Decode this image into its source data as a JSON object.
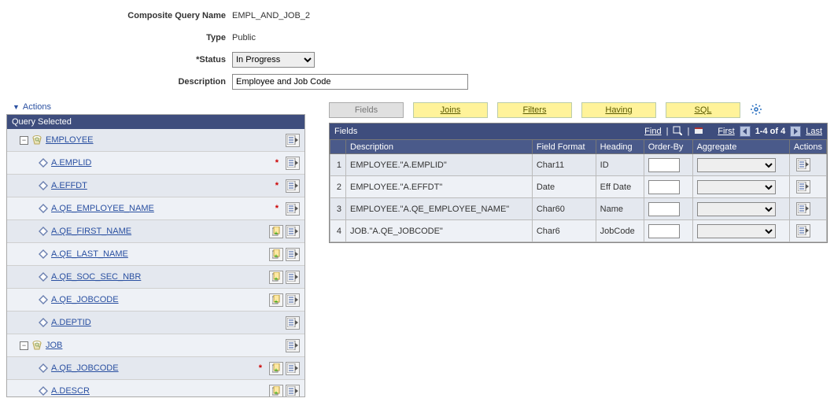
{
  "form": {
    "name_label": "Composite Query Name",
    "name_value": "EMPL_AND_JOB_2",
    "type_label": "Type",
    "type_value": "Public",
    "status_label": "*Status",
    "status_value": "In Progress",
    "desc_label": "Description",
    "desc_value": "Employee and Job Code"
  },
  "actions_link": "Actions",
  "query_selected_header": "Query Selected",
  "tree": [
    {
      "kind": "group",
      "label": "EMPLOYEE"
    },
    {
      "kind": "field",
      "label": "A.EMPLID",
      "req": true,
      "copy": false
    },
    {
      "kind": "field",
      "label": "A.EFFDT",
      "req": true,
      "copy": false
    },
    {
      "kind": "field",
      "label": "A.QE_EMPLOYEE_NAME",
      "req": true,
      "copy": false
    },
    {
      "kind": "field",
      "label": "A.QE_FIRST_NAME",
      "req": false,
      "copy": true
    },
    {
      "kind": "field",
      "label": "A.QE_LAST_NAME",
      "req": false,
      "copy": true
    },
    {
      "kind": "field",
      "label": "A.QE_SOC_SEC_NBR",
      "req": false,
      "copy": true
    },
    {
      "kind": "field",
      "label": "A.QE_JOBCODE",
      "req": false,
      "copy": true
    },
    {
      "kind": "field",
      "label": "A.DEPTID",
      "req": false,
      "copy": false
    },
    {
      "kind": "group",
      "label": "JOB"
    },
    {
      "kind": "field",
      "label": "A.QE_JOBCODE",
      "req": true,
      "copy": true
    },
    {
      "kind": "field",
      "label": "A.DESCR",
      "req": false,
      "copy": true
    }
  ],
  "tabs": {
    "fields": "Fields",
    "joins": "Joins",
    "filters": "Filters",
    "having": "Having",
    "sql": "SQL"
  },
  "grid": {
    "title": "Fields",
    "find": "Find",
    "first": "First",
    "range": "1-4 of 4",
    "last": "Last",
    "cols": {
      "num": "",
      "desc": "Description",
      "format": "Field Format",
      "heading": "Heading",
      "orderby": "Order-By",
      "aggregate": "Aggregate",
      "actions": "Actions"
    },
    "rows": [
      {
        "n": "1",
        "desc": "EMPLOYEE.\"A.EMPLID\"",
        "format": "Char11",
        "heading": "ID"
      },
      {
        "n": "2",
        "desc": "EMPLOYEE.\"A.EFFDT\"",
        "format": "Date",
        "heading": "Eff Date"
      },
      {
        "n": "3",
        "desc": "EMPLOYEE.\"A.QE_EMPLOYEE_NAME\"",
        "format": "Char60",
        "heading": "Name"
      },
      {
        "n": "4",
        "desc": "JOB.\"A.QE_JOBCODE\"",
        "format": "Char6",
        "heading": "JobCode"
      }
    ]
  }
}
